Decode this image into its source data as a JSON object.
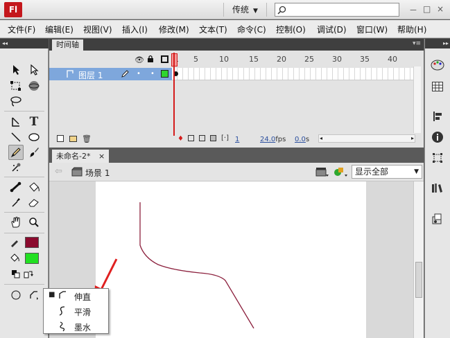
{
  "app": {
    "logo": "Fl"
  },
  "titlebar": {
    "workspace": "传统",
    "search_placeholder": "",
    "window_buttons": [
      "－",
      "□",
      "×"
    ]
  },
  "menubar": {
    "items": [
      "文件(F)",
      "编辑(E)",
      "视图(V)",
      "插入(I)",
      "修改(M)",
      "文本(T)",
      "命令(C)",
      "控制(O)",
      "调试(D)",
      "窗口(W)",
      "帮助(H)"
    ]
  },
  "timeline": {
    "tab_label": "时间轴",
    "frame_numbers": [
      "1",
      "5",
      "10",
      "15",
      "20",
      "25",
      "30",
      "35",
      "40"
    ],
    "layer": {
      "name": "图层 1"
    },
    "footer": {
      "current_frame": "1",
      "fps": "24.0",
      "fps_unit": "fps",
      "time": "0.0",
      "time_unit": "s"
    }
  },
  "document": {
    "tab_label": "未命名-2*",
    "close_glyph": "×",
    "scene_label": "场景 1",
    "zoom": "显示全部"
  },
  "colors": {
    "stroke_color": "#8b0a2e",
    "fill_color": "#22e022",
    "selected_layer": "#7ea7dc",
    "playhead": "#d41b1b",
    "stroke_path": "#8b1f3c",
    "annotation_arrow": "#e02020"
  },
  "popup": {
    "items": [
      {
        "label": "伸直",
        "icon": "straighten-icon",
        "checked": true
      },
      {
        "label": "平滑",
        "icon": "smooth-icon",
        "checked": false
      },
      {
        "label": "墨水",
        "icon": "ink-icon",
        "checked": false
      }
    ]
  }
}
